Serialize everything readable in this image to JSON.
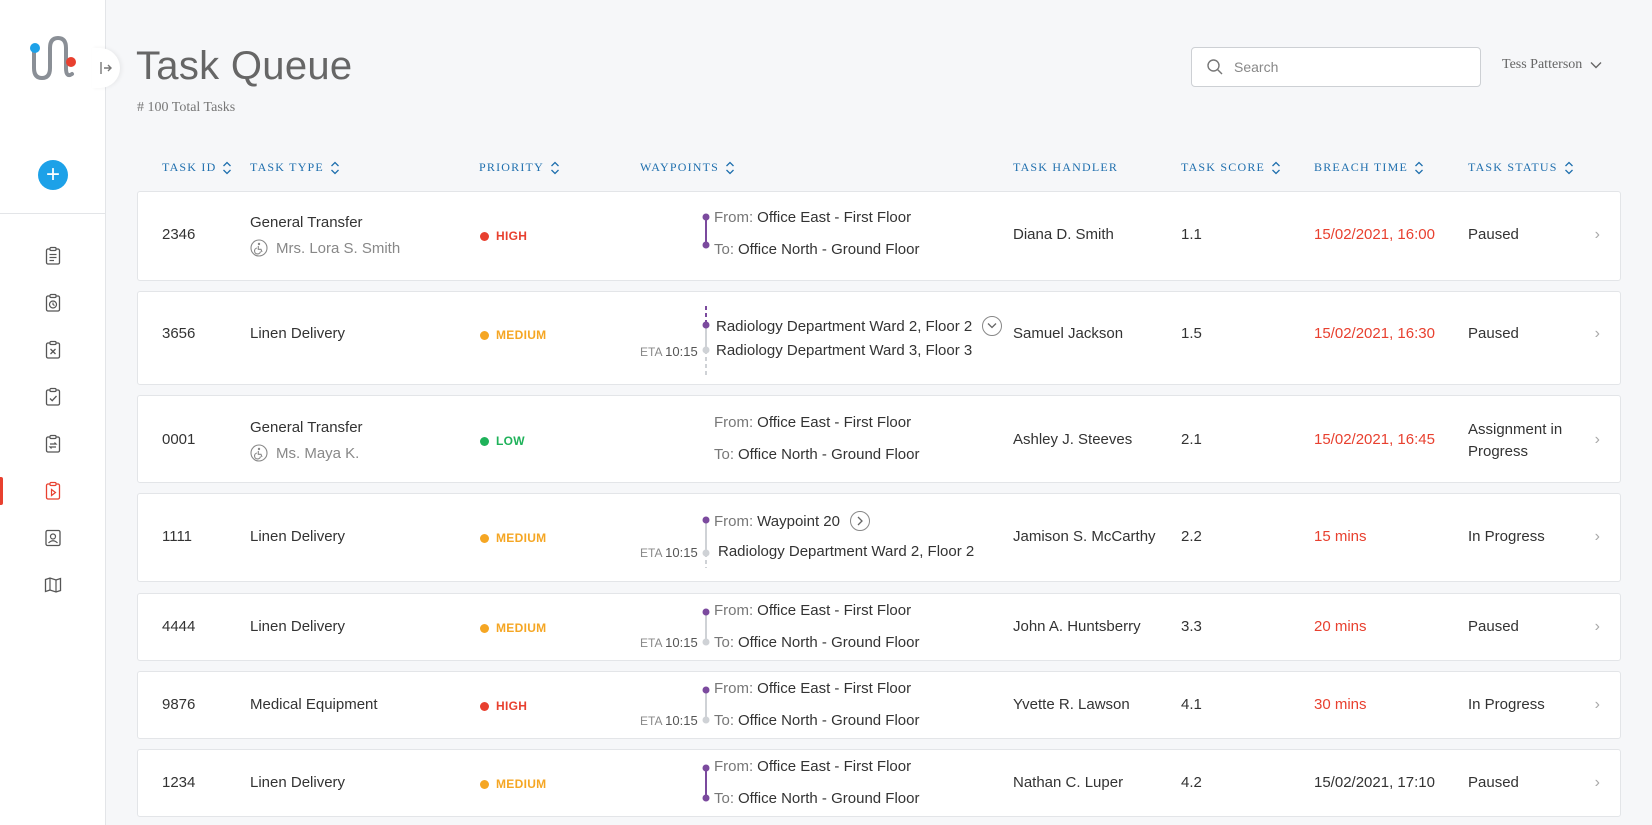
{
  "header": {
    "title": "Task Queue",
    "total_tasks": "# 100 Total Tasks",
    "search_placeholder": "Search",
    "user_name": "Tess Patterson"
  },
  "columns": {
    "task_id": "TASK ID",
    "task_type": "TASK TYPE",
    "priority": "PRIORITY",
    "waypoints": "WAYPOINTS",
    "task_handler": "TASK HANDLER",
    "task_score": "TASK SCORE",
    "breach_time": "BREACH TIME",
    "task_status": "TASK STATUS"
  },
  "colors": {
    "high": "#e8402f",
    "medium": "#f5a623",
    "low": "#1fb25a",
    "breach": "#e8402f",
    "track": "#7b4a9e",
    "accent": "#1f6fae",
    "add_button": "#1da1e8"
  },
  "sidebar_icons": [
    "clipboard-list-icon",
    "clipboard-timer-icon",
    "clipboard-x-icon",
    "clipboard-check-icon",
    "clipboard-transfer-icon",
    "clipboard-play-icon",
    "contact-card-icon",
    "map-icon"
  ],
  "rows": [
    {
      "id": "2346",
      "type": "General Transfer",
      "patient": "Mrs. Lora S. Smith",
      "priority": "HIGH",
      "wp_from_label": "From:",
      "wp_from": "Office East - First Floor",
      "wp_to_label": "To:",
      "wp_to": "Office North - Ground Floor",
      "eta_label": "",
      "eta_time": "",
      "handler": "Diana D. Smith",
      "score": "1.1",
      "breach": "15/02/2021, 16:00",
      "status": "Paused"
    },
    {
      "id": "3656",
      "type": "Linen Delivery",
      "patient": "",
      "priority": "MEDIUM",
      "wp_from_label": "",
      "wp_from": "Radiology Department Ward 2, Floor 2",
      "wp_to_label": "",
      "wp_to": "Radiology Department Ward 3, Floor 3",
      "eta_label": "ETA",
      "eta_time": "10:15",
      "handler": "Samuel Jackson",
      "score": "1.5",
      "breach": "15/02/2021, 16:30",
      "status": "Paused"
    },
    {
      "id": "0001",
      "type": "General Transfer",
      "patient": "Ms. Maya K.",
      "priority": "LOW",
      "wp_from_label": "From:",
      "wp_from": "Office East - First Floor",
      "wp_to_label": "To:",
      "wp_to": "Office North - Ground Floor",
      "eta_label": "",
      "eta_time": "",
      "handler": "Ashley J. Steeves",
      "score": "2.1",
      "breach": "15/02/2021, 16:45",
      "status": "Assignment in Progress"
    },
    {
      "id": "1111",
      "type": "Linen Delivery",
      "patient": "",
      "priority": "MEDIUM",
      "wp_from_label": "From:",
      "wp_from": "Waypoint 20",
      "wp_to_label": "",
      "wp_to": "Radiology Department Ward 2, Floor 2",
      "eta_label": "ETA",
      "eta_time": "10:15",
      "handler": "Jamison S. McCarthy",
      "score": "2.2",
      "breach": "15 mins",
      "status": "In Progress"
    },
    {
      "id": "4444",
      "type": "Linen Delivery",
      "patient": "",
      "priority": "MEDIUM",
      "wp_from_label": "From:",
      "wp_from": "Office East - First Floor",
      "wp_to_label": "To:",
      "wp_to": "Office North - Ground Floor",
      "eta_label": "ETA",
      "eta_time": "10:15",
      "handler": "John A. Huntsberry",
      "score": "3.3",
      "breach": "20 mins",
      "status": "Paused"
    },
    {
      "id": "9876",
      "type": "Medical Equipment",
      "patient": "",
      "priority": "HIGH",
      "wp_from_label": "From:",
      "wp_from": "Office East - First Floor",
      "wp_to_label": "To:",
      "wp_to": "Office North - Ground Floor",
      "eta_label": "ETA",
      "eta_time": "10:15",
      "handler": "Yvette R. Lawson",
      "score": "4.1",
      "breach": "30 mins",
      "status": "In Progress"
    },
    {
      "id": "1234",
      "type": "Linen Delivery",
      "patient": "",
      "priority": "MEDIUM",
      "wp_from_label": "From:",
      "wp_from": "Office East - First Floor",
      "wp_to_label": "To:",
      "wp_to": "Office North - Ground Floor",
      "eta_label": "",
      "eta_time": "",
      "handler": "Nathan C. Luper",
      "score": "4.2",
      "breach": "15/02/2021, 17:10",
      "status": "Paused"
    }
  ]
}
